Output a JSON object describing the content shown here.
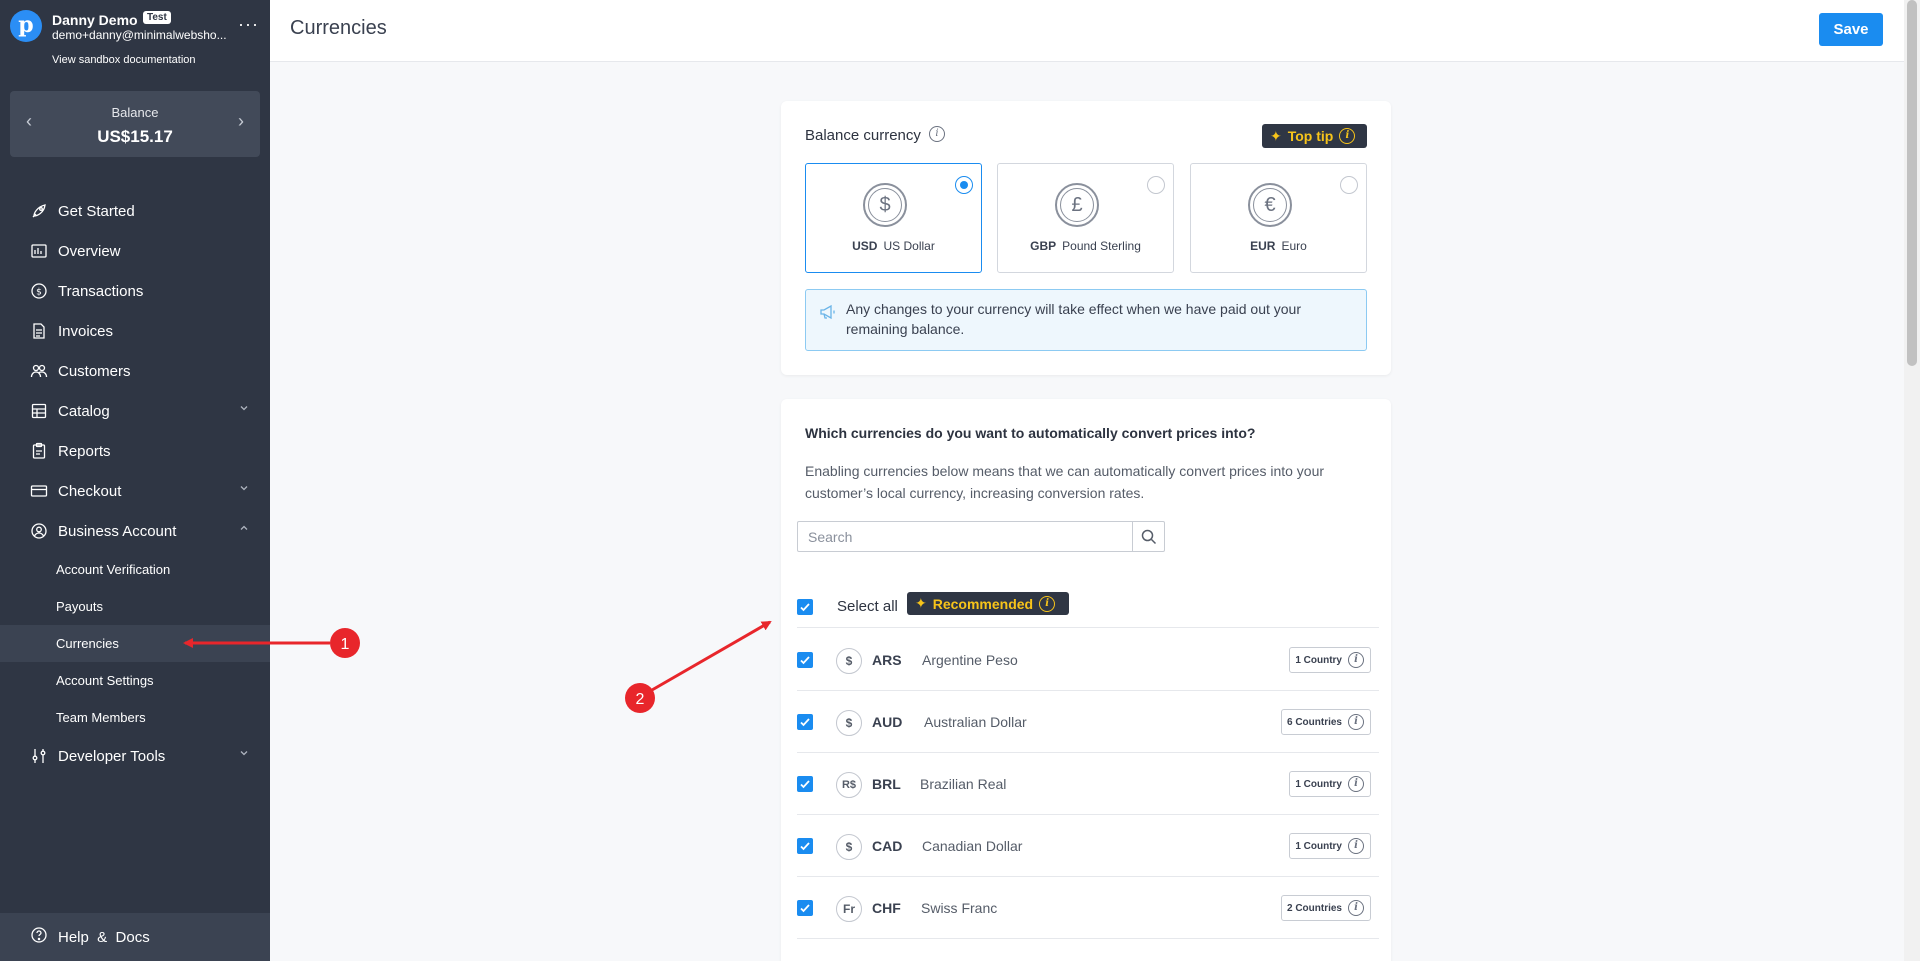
{
  "profile": {
    "logo_letter": "p",
    "name": "Danny Demo",
    "badge": "Test",
    "email": "demo+danny@minimalwebsho...",
    "sandbox_link": "View sandbox documentation",
    "more": "···"
  },
  "balance": {
    "label": "Balance",
    "value": "US$15.17",
    "prev": "‹",
    "next": "›"
  },
  "nav": {
    "get_started": "Get Started",
    "overview": "Overview",
    "transactions": "Transactions",
    "invoices": "Invoices",
    "customers": "Customers",
    "catalog": "Catalog",
    "reports": "Reports",
    "checkout": "Checkout",
    "business_account": "Business Account",
    "sub": {
      "account_verification": "Account Verification",
      "payouts": "Payouts",
      "currencies": "Currencies",
      "account_settings": "Account Settings",
      "team_members": "Team Members"
    },
    "developer_tools": "Developer Tools",
    "help": "Help  &  Docs"
  },
  "header": {
    "title": "Currencies",
    "save_label": "Save"
  },
  "balance_currency": {
    "label": "Balance currency",
    "top_tip": "Top tip",
    "options": [
      {
        "symbol": "$",
        "code": "USD",
        "name": "US Dollar",
        "selected": true
      },
      {
        "symbol": "£",
        "code": "GBP",
        "name": "Pound Sterling",
        "selected": false
      },
      {
        "symbol": "€",
        "code": "EUR",
        "name": "Euro",
        "selected": false
      }
    ],
    "notice": "Any changes to your currency will take effect when we have paid out your remaining balance."
  },
  "conversion": {
    "question": "Which currencies do you want to automatically convert prices into?",
    "description": "Enabling currencies below means that we can automatically convert prices into your customer’s local currency, increasing conversion rates.",
    "search_placeholder": "Search",
    "select_all": "Select all",
    "recommended": "Recommended",
    "rows": [
      {
        "symbol": "$",
        "code": "ARS",
        "name": "Argentine Peso",
        "countries": "1 Country"
      },
      {
        "symbol": "$",
        "code": "AUD",
        "name": "Australian Dollar",
        "countries": "6 Countries"
      },
      {
        "symbol": "R$",
        "code": "BRL",
        "name": "Brazilian Real",
        "countries": "1 Country"
      },
      {
        "symbol": "$",
        "code": "CAD",
        "name": "Canadian Dollar",
        "countries": "1 Country"
      },
      {
        "symbol": "Fr",
        "code": "CHF",
        "name": "Swiss Franc",
        "countries": "2 Countries"
      }
    ]
  },
  "annotations": {
    "marker_1": "1",
    "marker_2": "2"
  },
  "colors": {
    "accent": "#1a8cf0",
    "sidebar": "#2f3644",
    "highlight": "#f7c41a",
    "annotation": "#e8262b"
  }
}
